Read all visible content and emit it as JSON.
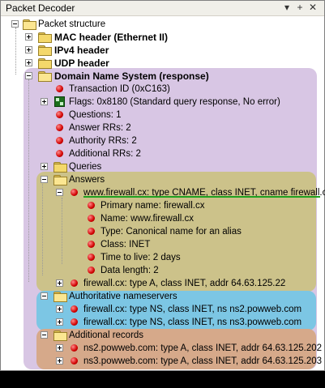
{
  "window": {
    "title": "Packet Decoder"
  },
  "colors": {
    "dns": "#d8c6e4",
    "answers": "#ccc28a",
    "authority": "#7cc6e4",
    "additional": "#d6a98a",
    "highlight": "#1fa01f"
  },
  "tree": {
    "root": "Packet structure",
    "mac": "MAC header (Ethernet II)",
    "ipv4": "IPv4 header",
    "udp": "UDP header",
    "dns": "Domain Name System (response)",
    "transaction_id": "Transaction ID (0xC163)",
    "flags": "Flags: 0x8180 (Standard query response, No error)",
    "questions": "Questions: 1",
    "answer_rrs": "Answer RRs: 2",
    "authority_rrs": "Authority RRs: 2",
    "additional_rrs": "Additional RRs: 2",
    "queries": "Queries",
    "answers": "Answers",
    "answer1": "www.firewall.cx: type CNAME, class INET, cname firewall.cx",
    "answer1_fields": [
      "Primary name: firewall.cx",
      "Name: www.firewall.cx",
      "Type: Canonical name for an alias",
      "Class: INET",
      "Time to live: 2 days",
      "Data length: 2"
    ],
    "answer2": "firewall.cx: type A, class INET, addr 64.63.125.22",
    "authoritative": "Authoritative nameservers",
    "auth1": "firewall.cx: type NS, class INET, ns ns2.powweb.com",
    "auth2": "firewall.cx: type NS, class INET, ns ns3.powweb.com",
    "additional": "Additional records",
    "add1": "ns2.powweb.com: type A, class INET, addr 64.63.125.202",
    "add2": "ns3.powweb.com: type A, class INET, addr 64.63.125.203"
  }
}
